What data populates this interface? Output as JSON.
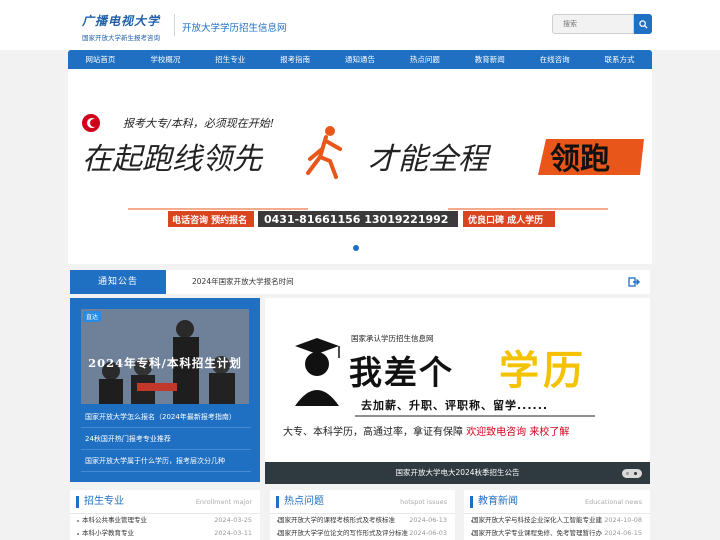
{
  "header": {
    "logo_title": "广播电视大学",
    "logo_subtitle": "国家开放大学新生报考咨询",
    "site_name": "开放大学学历招生信息网",
    "search_placeholder": "搜索"
  },
  "nav": {
    "items": [
      "网站首页",
      "学校概况",
      "招生专业",
      "报考指南",
      "通知通告",
      "热点问题",
      "教育新闻",
      "在线咨询",
      "联系方式"
    ]
  },
  "banner": {
    "tagline": "报考大专/本科，必须现在开始!",
    "headline_left": "在起跑线领先",
    "headline_right": "才能全程",
    "badge": "领跑",
    "contact_label": "电话咨询 预约报名",
    "phone": "0431-81661156  13019221992",
    "reputation": "优良口碑 成人学历"
  },
  "notice": {
    "label": "通知公告",
    "text": "2024年国家开放大学报名时间"
  },
  "left_promo": {
    "tag": "直达",
    "title": "2024年专科/本科招生计划",
    "links": [
      "国家开放大学怎么报名（2024年最新报考指南）",
      "24秋国开热门报考专业推荐",
      "国家开放大学属于什么学历，报考层次分几种"
    ]
  },
  "ad": {
    "site": "国家承认学历招生信息网",
    "big_left": "我差个",
    "big_right": "学历",
    "slogan": "去加薪、升职、评职称、留学......",
    "bottom_left": "大专、本科学历，高通过率，拿证有保障",
    "bottom_right": "欢迎致电咨询  来校了解",
    "caption": "国家开放大学电大2024秋季招生公告"
  },
  "panels": [
    {
      "title": "招生专业",
      "en": "Enrollment major",
      "rows": [
        {
          "text": "本科公共事业管理专业",
          "date": "2024-03-25"
        },
        {
          "text": "本科小学教育专业",
          "date": "2024-03-11"
        }
      ]
    },
    {
      "title": "热点问题",
      "en": "hotspot issues",
      "rows": [
        {
          "text": "国家开放大学的课程考核形式及考核标准",
          "date": "2024-06-13"
        },
        {
          "text": "国家开放大学学位论文的写作形式及评分标准",
          "date": "2024-06-03"
        }
      ]
    },
    {
      "title": "教育新闻",
      "en": "Educational news",
      "rows": [
        {
          "text": "国家开放大学与科技企业深化人工智能专业建",
          "date": "2024-10-08"
        },
        {
          "text": "国家开放大学专业课程免修、免考管理暂行办",
          "date": "2024-06-15"
        }
      ]
    }
  ],
  "colors": {
    "brand_blue": "#1f6fc2",
    "accent_orange": "#e8561a",
    "ad_yellow": "#f5c200",
    "ad_red": "#d0021b"
  }
}
